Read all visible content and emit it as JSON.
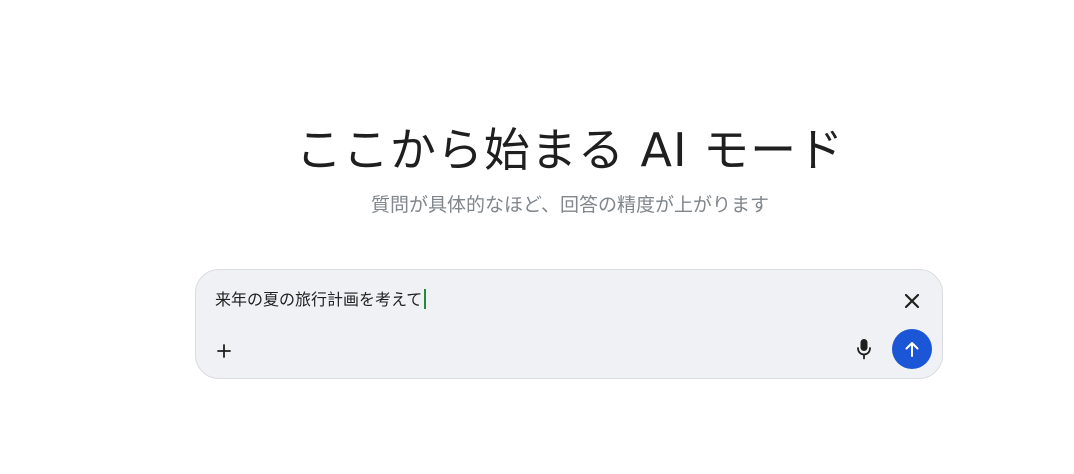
{
  "hero": {
    "title": "ここから始まる AI モード",
    "subtitle": "質問が具体的なほど、回答の精度が上がります"
  },
  "composer": {
    "input_value": "来年の夏の旅行計画を考えて",
    "icons": {
      "clear": "close-icon",
      "add": "plus-icon",
      "mic": "microphone-icon",
      "send": "arrow-up-icon"
    },
    "colors": {
      "background": "#f0f1f4",
      "send_button": "#1a56d6",
      "caret": "#1e8e3e"
    }
  }
}
